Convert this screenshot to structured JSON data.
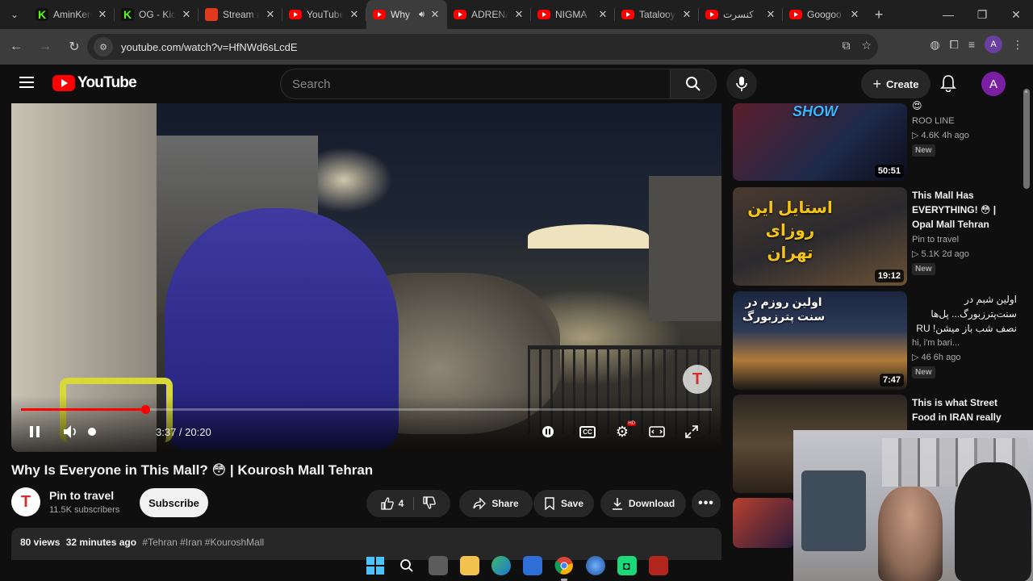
{
  "browser": {
    "tabs": [
      {
        "title": "AminKen",
        "icon": "kick-icon",
        "active": false
      },
      {
        "title": "OG - Kick",
        "icon": "kick-icon",
        "active": false
      },
      {
        "title": "Stream a",
        "icon": "stream-icon",
        "active": false
      },
      {
        "title": "YouTube",
        "icon": "youtube-icon",
        "active": false
      },
      {
        "title": "Why",
        "icon": "youtube-icon",
        "active": true
      },
      {
        "title": "ADRENA",
        "icon": "youtube-icon",
        "active": false
      },
      {
        "title": "NIGMA",
        "icon": "youtube-icon",
        "active": false
      },
      {
        "title": "Tatalooy",
        "icon": "youtube-icon",
        "active": false
      },
      {
        "title": "کنسرت",
        "icon": "youtube-icon",
        "active": false
      },
      {
        "title": "Googoo",
        "icon": "youtube-icon",
        "active": false
      }
    ],
    "url": "youtube.com/watch?v=HfNWd6sLcdE",
    "profile_initial": "A"
  },
  "youtube_header": {
    "logo_text": "YouTube",
    "search_placeholder": "Search",
    "create_label": "Create",
    "avatar_initial": "A"
  },
  "player": {
    "current_time": "3:37",
    "duration": "20:20",
    "time_readout": "3:37 / 20:20",
    "progress_fraction": 0.18,
    "watermark_letter": "T",
    "hd_badge": "HD"
  },
  "video": {
    "title": "Why Is Everyone in This Mall? 😳 | Kourosh Mall Tehran",
    "channel_name": "Pin to travel",
    "channel_avatar_letter": "T",
    "subscribers": "11.5K subscribers",
    "subscribe_label": "Subscribe",
    "likes": "4",
    "share_label": "Share",
    "save_label": "Save",
    "download_label": "Download",
    "views": "80 views",
    "posted": "32 minutes ago",
    "hashtags": "#Tehran #Iran #KouroshMall"
  },
  "recommendations": [
    {
      "title": "😍",
      "channel": "ROO LINE",
      "meta": "▷ 4.6K  4h ago",
      "badge": "New",
      "duration": "50:51",
      "thumb_text": "SHOW"
    },
    {
      "title": "This Mall Has EVERYTHING! 😳 | Opal Mall Tehran",
      "channel": "Pin to travel",
      "meta": "▷ 5.1K  2d ago",
      "badge": "New",
      "duration": "19:12",
      "thumb_text": "استایل این روزای تهران"
    },
    {
      "title": "اولین شبم در سنت‌پترزبورگ... پل‌ها نصف شب باز میشن! RU",
      "channel": "hi, i'm bari...",
      "meta": "▷ 46  6h ago",
      "badge": "New",
      "duration": "7:47",
      "thumb_text": "اولین روزم در سنت پترزبورگ"
    },
    {
      "title": "This is what Street Food in IRAN really",
      "channel": "",
      "meta": "",
      "badge": "",
      "duration": "",
      "thumb_text": ""
    }
  ]
}
